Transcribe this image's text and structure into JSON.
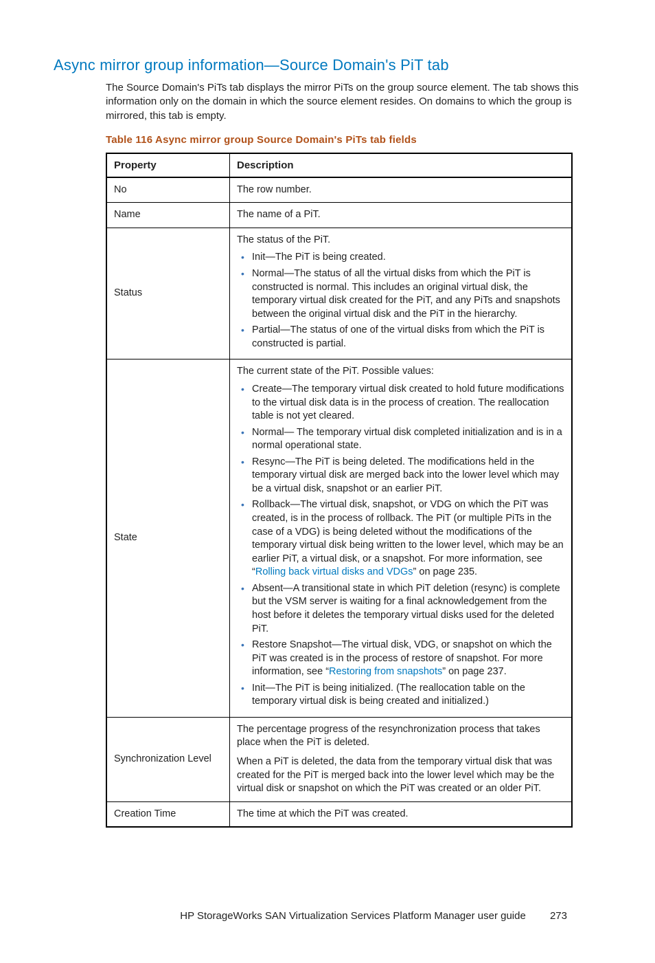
{
  "section_title": "Async mirror group information—Source Domain's PiT tab",
  "intro": "The Source Domain's PiTs tab displays the mirror PiTs on the group source element. The tab shows this information only on the domain in which the source element resides. On domains to which the group is mirrored, this tab is empty.",
  "table_title": "Table 116 Async mirror group Source Domain's PiTs tab fields",
  "header": {
    "property": "Property",
    "description": "Description"
  },
  "rows": {
    "no": {
      "prop": "No",
      "desc": "The row number."
    },
    "name": {
      "prop": "Name",
      "desc": "The name of a PiT."
    },
    "status": {
      "prop": "Status",
      "lead": "The status of the PiT.",
      "items": [
        "Init—The PiT is being created.",
        "Normal—The status of all the virtual disks from which the PiT is constructed is normal. This includes an original virtual disk, the temporary virtual disk created for the PiT, and any PiTs and snapshots between the original virtual disk and the PiT in the hierarchy.",
        "Partial—The status of one of the virtual disks from which the PiT is constructed is partial."
      ]
    },
    "state": {
      "prop": "State",
      "lead": "The current state of the PiT. Possible values:",
      "create": "Create—The temporary virtual disk created to hold future modifications to the virtual disk data is in the process of creation. The reallocation table is not yet cleared.",
      "normal": "Normal— The temporary virtual disk completed initialization and is in a normal operational state.",
      "resync": "Resync—The PiT is being deleted. The modifications held in the temporary virtual disk are merged back into the lower level which may be a virtual disk, snapshot or an earlier PiT.",
      "rollback_pre": "Rollback—The virtual disk, snapshot, or VDG on which the PiT was created, is in the process of rollback. The PiT (or multiple PiTs in the case of a VDG) is being deleted without the modifications of the temporary virtual disk being written to the lower level, which may be an earlier PiT, a virtual disk, or a snapshot. For more information, see “",
      "rollback_link": "Rolling back virtual disks and VDGs",
      "rollback_post": "” on page 235.",
      "absent": "Absent—A transitional state in which PiT deletion (resync) is complete but the VSM server is waiting for a final acknowledgement from the host before it deletes the temporary virtual disks used for the deleted PiT.",
      "restore_pre": "Restore Snapshot—The virtual disk, VDG, or snapshot on which the PiT was created is in the process of restore of snapshot. For more information, see “",
      "restore_link": "Restoring from snapshots",
      "restore_post": "” on page 237.",
      "init": "Init—The PiT is being initialized. (The reallocation table on the temporary virtual disk is being created and initialized.)"
    },
    "sync": {
      "prop": "Synchronization Level",
      "p1": "The percentage progress of the resynchronization process that takes place when the PiT is deleted.",
      "p2": "When a PiT is deleted, the data from the temporary virtual disk that was created for the PiT is merged back into the lower level which may be the virtual disk or snapshot on which the PiT was created or an older PiT."
    },
    "creation": {
      "prop": "Creation Time",
      "desc": "The time at which the PiT was created."
    }
  },
  "footer": {
    "doc_title": "HP StorageWorks SAN Virtualization Services Platform Manager user guide",
    "page": "273"
  },
  "chart_data": {
    "type": "table",
    "title": "Table 116 Async mirror group Source Domain's PiTs tab fields",
    "columns": [
      "Property",
      "Description"
    ],
    "rows": [
      [
        "No",
        "The row number."
      ],
      [
        "Name",
        "The name of a PiT."
      ],
      [
        "Status",
        "The status of the PiT. • Init—The PiT is being created. • Normal—The status of all the virtual disks from which the PiT is constructed is normal. This includes an original virtual disk, the temporary virtual disk created for the PiT, and any PiTs and snapshots between the original virtual disk and the PiT in the hierarchy. • Partial—The status of one of the virtual disks from which the PiT is constructed is partial."
      ],
      [
        "State",
        "The current state of the PiT. Possible values: • Create—The temporary virtual disk created to hold future modifications to the virtual disk data is in the process of creation. The reallocation table is not yet cleared. • Normal— The temporary virtual disk completed initialization and is in a normal operational state. • Resync—The PiT is being deleted. The modifications held in the temporary virtual disk are merged back into the lower level which may be a virtual disk, snapshot or an earlier PiT. • Rollback—The virtual disk, snapshot, or VDG on which the PiT was created, is in the process of rollback. The PiT (or multiple PiTs in the case of a VDG) is being deleted without the modifications of the temporary virtual disk being written to the lower level, which may be an earlier PiT, a virtual disk, or a snapshot. For more information, see “Rolling back virtual disks and VDGs” on page 235. • Absent—A transitional state in which PiT deletion (resync) is complete but the VSM server is waiting for a final acknowledgement from the host before it deletes the temporary virtual disks used for the deleted PiT. • Restore Snapshot—The virtual disk, VDG, or snapshot on which the PiT was created is in the process of restore of snapshot. For more information, see “Restoring from snapshots” on page 237. • Init—The PiT is being initialized. (The reallocation table on the temporary virtual disk is being created and initialized.)"
      ],
      [
        "Synchronization Level",
        "The percentage progress of the resynchronization process that takes place when the PiT is deleted. When a PiT is deleted, the data from the temporary virtual disk that was created for the PiT is merged back into the lower level which may be the virtual disk or snapshot on which the PiT was created or an older PiT."
      ],
      [
        "Creation Time",
        "The time at which the PiT was created."
      ]
    ]
  }
}
